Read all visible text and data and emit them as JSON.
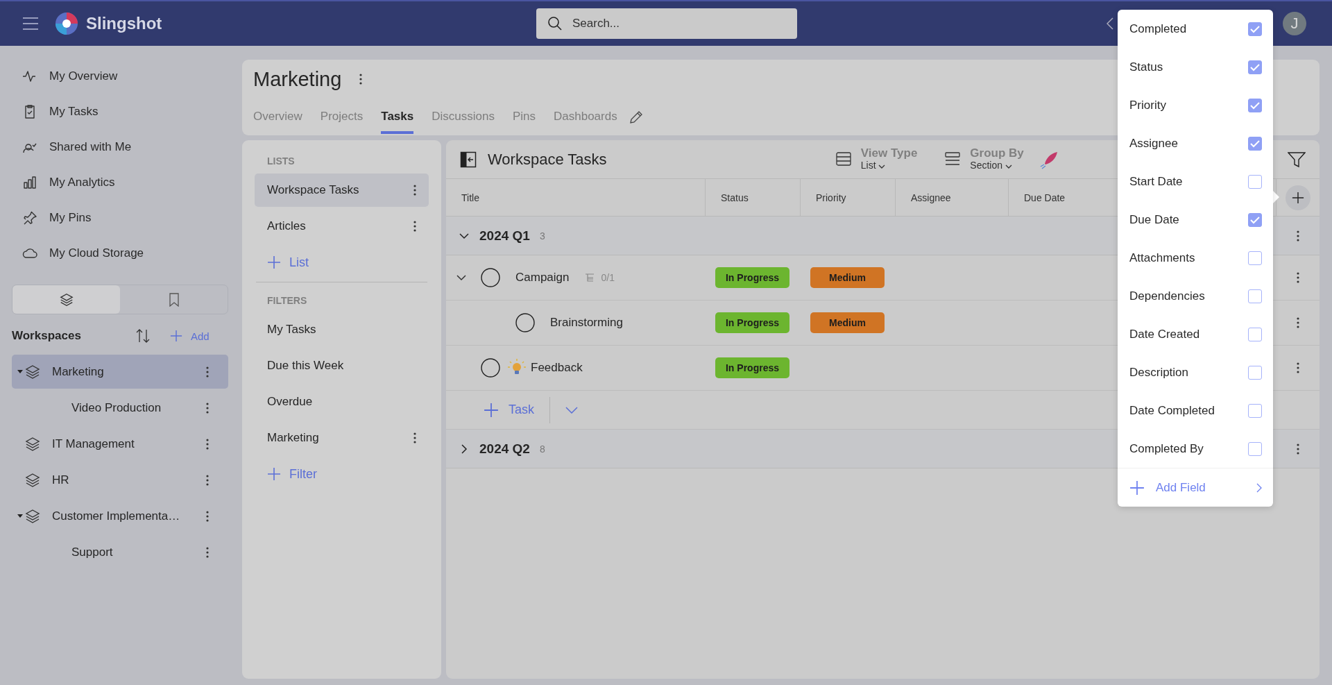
{
  "app": {
    "name": "Slingshot"
  },
  "search": {
    "placeholder": "Search..."
  },
  "user": {
    "initial": "J"
  },
  "nav": [
    {
      "label": "My Overview",
      "kind": "pulse"
    },
    {
      "label": "My Tasks",
      "kind": "clipboard"
    },
    {
      "label": "Shared with Me",
      "kind": "person"
    },
    {
      "label": "My Analytics",
      "kind": "chart"
    },
    {
      "label": "My Pins",
      "kind": "pin"
    },
    {
      "label": "My Cloud Storage",
      "kind": "cloud"
    }
  ],
  "sidebar_tabs": [
    {
      "kind": "layers",
      "selected": true
    },
    {
      "kind": "bookmark",
      "selected": false
    }
  ],
  "workspaces": {
    "title": "Workspaces",
    "add_label": "Add",
    "items": [
      {
        "label": "Marketing",
        "selected": true,
        "expanded": true,
        "children": [
          {
            "label": "Video Production",
            "selected": false
          }
        ]
      },
      {
        "label": "IT Management",
        "selected": false
      },
      {
        "label": "HR",
        "selected": false
      },
      {
        "label": "Customer Implementa…",
        "selected": false,
        "expanded": true,
        "children": [
          {
            "label": "Support",
            "selected": false
          }
        ]
      }
    ]
  },
  "workspace": {
    "title": "Marketing",
    "tabs": [
      {
        "label": "Overview",
        "selected": false
      },
      {
        "label": "Projects",
        "selected": false
      },
      {
        "label": "Tasks",
        "selected": true
      },
      {
        "label": "Discussions",
        "selected": false
      },
      {
        "label": "Pins",
        "selected": false
      },
      {
        "label": "Dashboards",
        "selected": false
      }
    ]
  },
  "lists": {
    "heading": "LISTS",
    "items": [
      {
        "label": "Workspace Tasks",
        "selected": true
      },
      {
        "label": "Articles",
        "selected": false
      }
    ],
    "add_label": "List"
  },
  "filters": {
    "heading": "FILTERS",
    "items": [
      {
        "label": "My Tasks",
        "has_menu": false
      },
      {
        "label": "Due this Week",
        "has_menu": false
      },
      {
        "label": "Overdue",
        "has_menu": false
      },
      {
        "label": "Marketing",
        "has_menu": true
      }
    ],
    "add_label": "Filter"
  },
  "task_view": {
    "title": "Workspace Tasks",
    "view_type": {
      "label": "View Type",
      "value": "List"
    },
    "group_by": {
      "label": "Group By",
      "value": "Section"
    },
    "columns": [
      "Title",
      "Status",
      "Priority",
      "Assignee",
      "Due Date"
    ],
    "sections": [
      {
        "name": "2024 Q1",
        "count": "3",
        "expanded": true,
        "add_task_label": "Task",
        "tasks": [
          {
            "title": "Campaign",
            "completed": false,
            "expanded": true,
            "subtasks": "0/1",
            "status": {
              "label": "In Progress",
              "color": "#6cb52f"
            },
            "priority": {
              "label": "Medium",
              "color": "#d07424"
            },
            "children": [
              {
                "title": "Brainstorming",
                "completed": false,
                "status": {
                  "label": "In Progress",
                  "color": "#6cb52f"
                },
                "priority": {
                  "label": "Medium",
                  "color": "#d07424"
                }
              }
            ]
          },
          {
            "title": "Feedback",
            "completed": false,
            "has_icon": true,
            "status": {
              "label": "In Progress",
              "color": "#6cb52f"
            }
          }
        ]
      },
      {
        "name": "2024 Q2",
        "count": "8",
        "expanded": false
      }
    ]
  },
  "field_menu": {
    "items": [
      {
        "label": "Completed",
        "checked": true
      },
      {
        "label": "Status",
        "checked": true
      },
      {
        "label": "Priority",
        "checked": true
      },
      {
        "label": "Assignee",
        "checked": true
      },
      {
        "label": "Start Date",
        "checked": false
      },
      {
        "label": "Due Date",
        "checked": true
      },
      {
        "label": "Attachments",
        "checked": false
      },
      {
        "label": "Dependencies",
        "checked": false
      },
      {
        "label": "Date Created",
        "checked": false
      },
      {
        "label": "Description",
        "checked": false
      },
      {
        "label": "Date Completed",
        "checked": false
      },
      {
        "label": "Completed By",
        "checked": false
      }
    ],
    "add_label": "Add Field"
  }
}
